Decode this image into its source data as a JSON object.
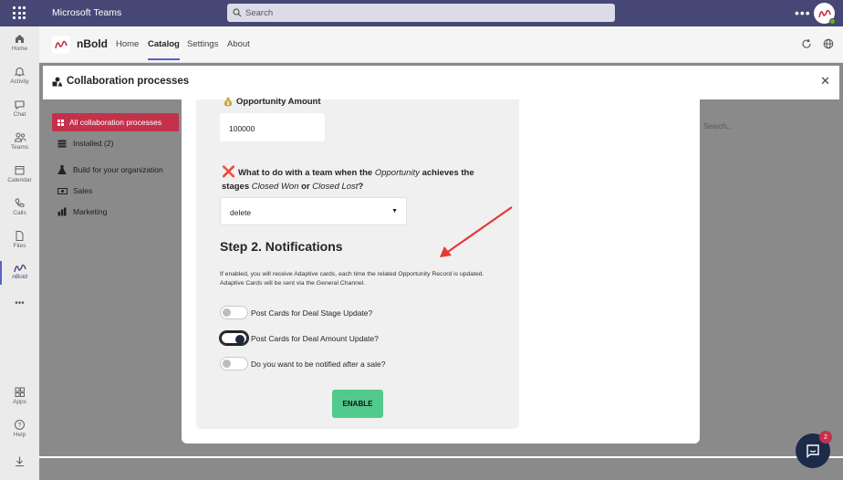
{
  "topbar": {
    "app_title": "Microsoft Teams",
    "search_placeholder": "Search",
    "more": "•••"
  },
  "rail": {
    "items": [
      {
        "label": "Home"
      },
      {
        "label": "Activity"
      },
      {
        "label": "Chat"
      },
      {
        "label": "Teams"
      },
      {
        "label": "Calendar"
      },
      {
        "label": "Calls"
      },
      {
        "label": "Files"
      },
      {
        "label": "nBold"
      },
      {
        "label": "•••"
      },
      {
        "label": "Apps"
      },
      {
        "label": "Help"
      }
    ]
  },
  "appheader": {
    "name": "nBold",
    "tabs": [
      {
        "label": "Home"
      },
      {
        "label": "Catalog"
      },
      {
        "label": "Settings"
      },
      {
        "label": "About"
      }
    ],
    "active_tab": "Catalog"
  },
  "background": {
    "search_placeholder": "Search..."
  },
  "modal": {
    "title": "Collaboration processes",
    "sidebar": {
      "active": "All collaboration processes",
      "items": [
        {
          "label": "Installed (2)"
        },
        {
          "label": "Build for your organization"
        },
        {
          "label": "Sales"
        },
        {
          "label": "Marketing"
        }
      ]
    },
    "form": {
      "amount_label": "Opportunity Amount",
      "amount_value": "100000",
      "question_part1": "What to do with a team when the ",
      "question_em1": "Opportunity",
      "question_part2": " achieves the stages ",
      "question_em2": "Closed Won",
      "question_part3": " or ",
      "question_em3": "Closed Lost",
      "question_part4": "?",
      "select_value": "delete",
      "step_title": "Step 2. Notifications",
      "description": "If enabled, you will receive Adaptive cards, each time the related Opportunity Record is updated. Adaptive Cards will be sent via the General Channel.",
      "toggles": [
        {
          "label": "Post Cards for Deal Stage Update?",
          "on": false
        },
        {
          "label": "Post Cards for Deal Amount Update?",
          "on": true
        },
        {
          "label": "Do you want to be notified after a sale?",
          "on": false
        }
      ],
      "enable_label": "ENABLE"
    }
  },
  "chat": {
    "badge": "2"
  },
  "colors": {
    "teams_purple": "#464775",
    "accent_red": "#c4314b",
    "enable_green": "#52c98d",
    "arrow_red": "#e53935"
  }
}
